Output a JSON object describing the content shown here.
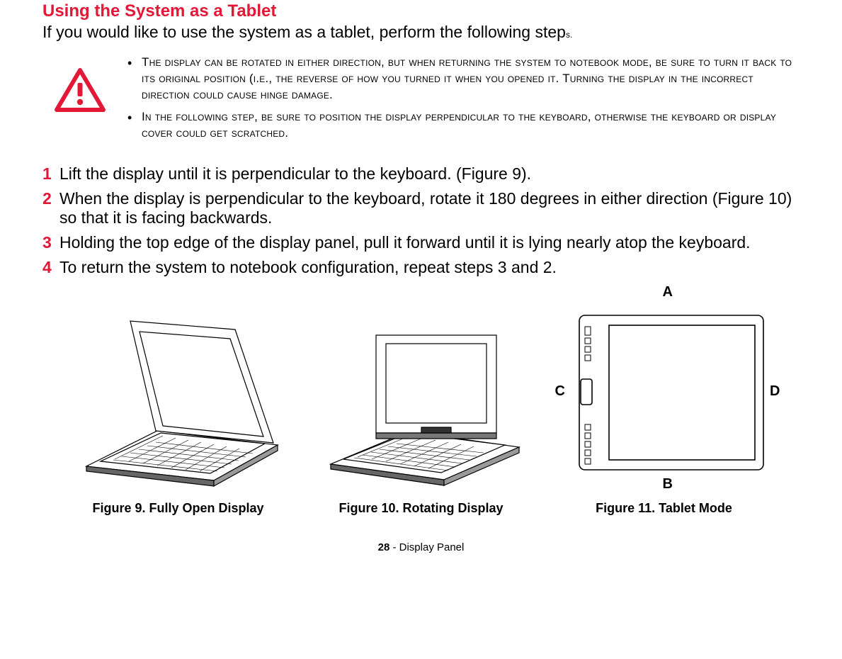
{
  "heading": "Using the System as a Tablet",
  "intro_main": "If you would like to use the system as a tablet, perform the following step",
  "intro_tail": "s.",
  "warnings": [
    "The display can be rotated in either direction, but when returning the system to notebook mode, be sure to turn it back to its original position (i.e., the reverse of how you turned it when you opened it. Turning the display in the incorrect direction could cause hinge damage.",
    "In the following step, be sure to position the display perpendicular to the keyboard, otherwise the keyboard or display cover could get scratched."
  ],
  "steps": [
    {
      "n": "1",
      "text": "Lift the display until it is perpendicular to the keyboard. (Figure 9)."
    },
    {
      "n": "2",
      "text": "When the display is perpendicular to the keyboard, rotate it 180 degrees in either direction (Figure 10) so that it is facing backwards."
    },
    {
      "n": "3",
      "text": "Holding the top edge of the display panel, pull it forward until it is lying nearly atop the keyboard."
    },
    {
      "n": "4",
      "text": "To return the system to notebook configuration, repeat steps 3 and 2."
    }
  ],
  "figures": {
    "fig9": "Figure 9.  Fully Open Display",
    "fig10": "Figure 10.  Rotating Display",
    "fig11": "Figure 11.  Tablet Mode"
  },
  "fig11_labels": {
    "A": "A",
    "B": "B",
    "C": "C",
    "D": "D"
  },
  "footer": {
    "page": "28",
    "section": " - Display Panel"
  }
}
